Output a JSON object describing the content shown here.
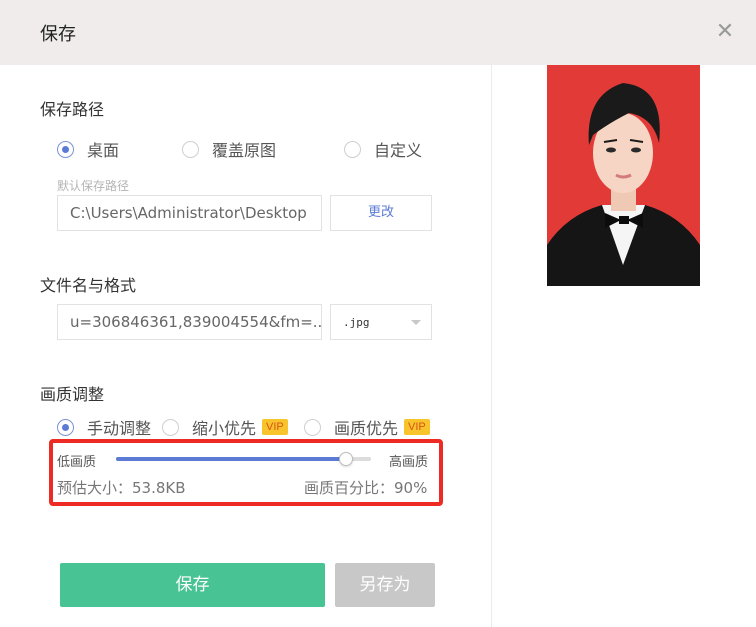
{
  "dialog": {
    "title": "保存",
    "close_icon": "close-icon"
  },
  "save_path": {
    "title": "保存路径",
    "options": [
      {
        "label": "桌面",
        "checked": true
      },
      {
        "label": "覆盖原图",
        "checked": false
      },
      {
        "label": "自定义",
        "checked": false
      }
    ],
    "hint": "默认保存路径",
    "path_value": "C:\\Users\\Administrator\\Desktop",
    "change_label": "更改"
  },
  "file": {
    "title": "文件名与格式",
    "name_value": "u=306846361,839004554&fm=...",
    "format_value": ".jpg"
  },
  "quality": {
    "title": "画质调整",
    "modes": [
      {
        "label": "手动调整",
        "checked": true,
        "vip": ""
      },
      {
        "label": "缩小优先",
        "checked": false,
        "vip": "VIP"
      },
      {
        "label": "画质优先",
        "checked": false,
        "vip": "VIP"
      }
    ],
    "low_label": "低画质",
    "high_label": "高画质",
    "slider_value_percent": 90,
    "size_text": "预估大小：53.8KB",
    "ratio_text": "画质百分比：90%"
  },
  "actions": {
    "save_label": "保存",
    "save_as_label": "另存为"
  },
  "colors": {
    "accent": "#5b7bd5",
    "primary_button": "#48c494",
    "highlight_box": "#ee2a24",
    "vip_badge": "#f7c52b",
    "preview_background": "#e23a37"
  }
}
